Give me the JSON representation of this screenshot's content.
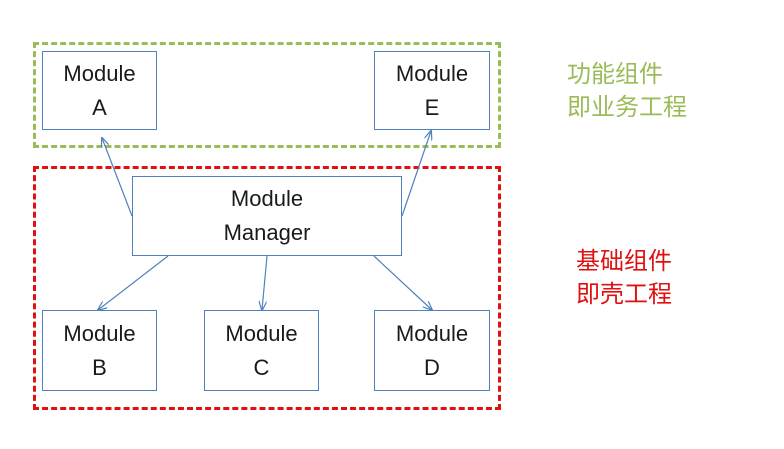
{
  "groups": {
    "functional": {
      "label_line1": "功能组件",
      "label_line2": "即业务工程",
      "color": "#9bbb59"
    },
    "base": {
      "label_line1": "基础组件",
      "label_line2": "即壳工程",
      "color": "#e01010"
    }
  },
  "modules": {
    "a": {
      "line1": "Module",
      "line2": "A"
    },
    "e": {
      "line1": "Module",
      "line2": "E"
    },
    "manager": {
      "line1": "Module",
      "line2": "Manager"
    },
    "b": {
      "line1": "Module",
      "line2": "B"
    },
    "c": {
      "line1": "Module",
      "line2": "C"
    },
    "d": {
      "line1": "Module",
      "line2": "D"
    }
  },
  "edges": [
    {
      "from": "manager",
      "to": "a"
    },
    {
      "from": "manager",
      "to": "e"
    },
    {
      "from": "manager",
      "to": "b"
    },
    {
      "from": "manager",
      "to": "c"
    },
    {
      "from": "manager",
      "to": "d"
    }
  ],
  "colors": {
    "box_border": "#4f81bd",
    "arrow": "#4f81bd"
  }
}
